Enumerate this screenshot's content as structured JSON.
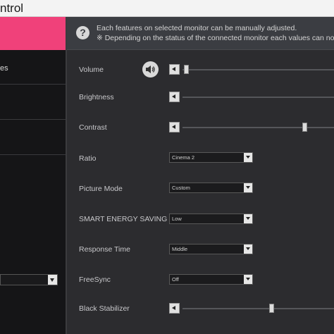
{
  "window": {
    "title": "ntrol"
  },
  "sidebar": {
    "active_label": "es",
    "dropdown_value": ""
  },
  "info": {
    "icon": "question-icon",
    "line1": "Each features on selected monitor can be manually adjusted.",
    "line2": "※ Depending on the status of the connected monitor each values can not be"
  },
  "controls": {
    "volume": {
      "label": "Volume",
      "value_fraction": 0.0
    },
    "brightness": {
      "label": "Brightness",
      "value_fraction": null
    },
    "contrast": {
      "label": "Contrast",
      "value_fraction": 0.8
    },
    "ratio": {
      "label": "Ratio",
      "value": "Cinema 2"
    },
    "picture_mode": {
      "label": "Picture Mode",
      "value": "Custom"
    },
    "smart_energy_saving": {
      "label": "SMART ENERGY SAVING",
      "value": "Low"
    },
    "response_time": {
      "label": "Response Time",
      "value": "Middle"
    },
    "freesync": {
      "label": "FreeSync",
      "value": "Off"
    },
    "black_stabilizer": {
      "label": "Black Stabilizer",
      "value_fraction": 0.58
    }
  },
  "colors": {
    "accent": "#f0417a",
    "background": "#2c2c2f",
    "sidebar": "#151517"
  }
}
